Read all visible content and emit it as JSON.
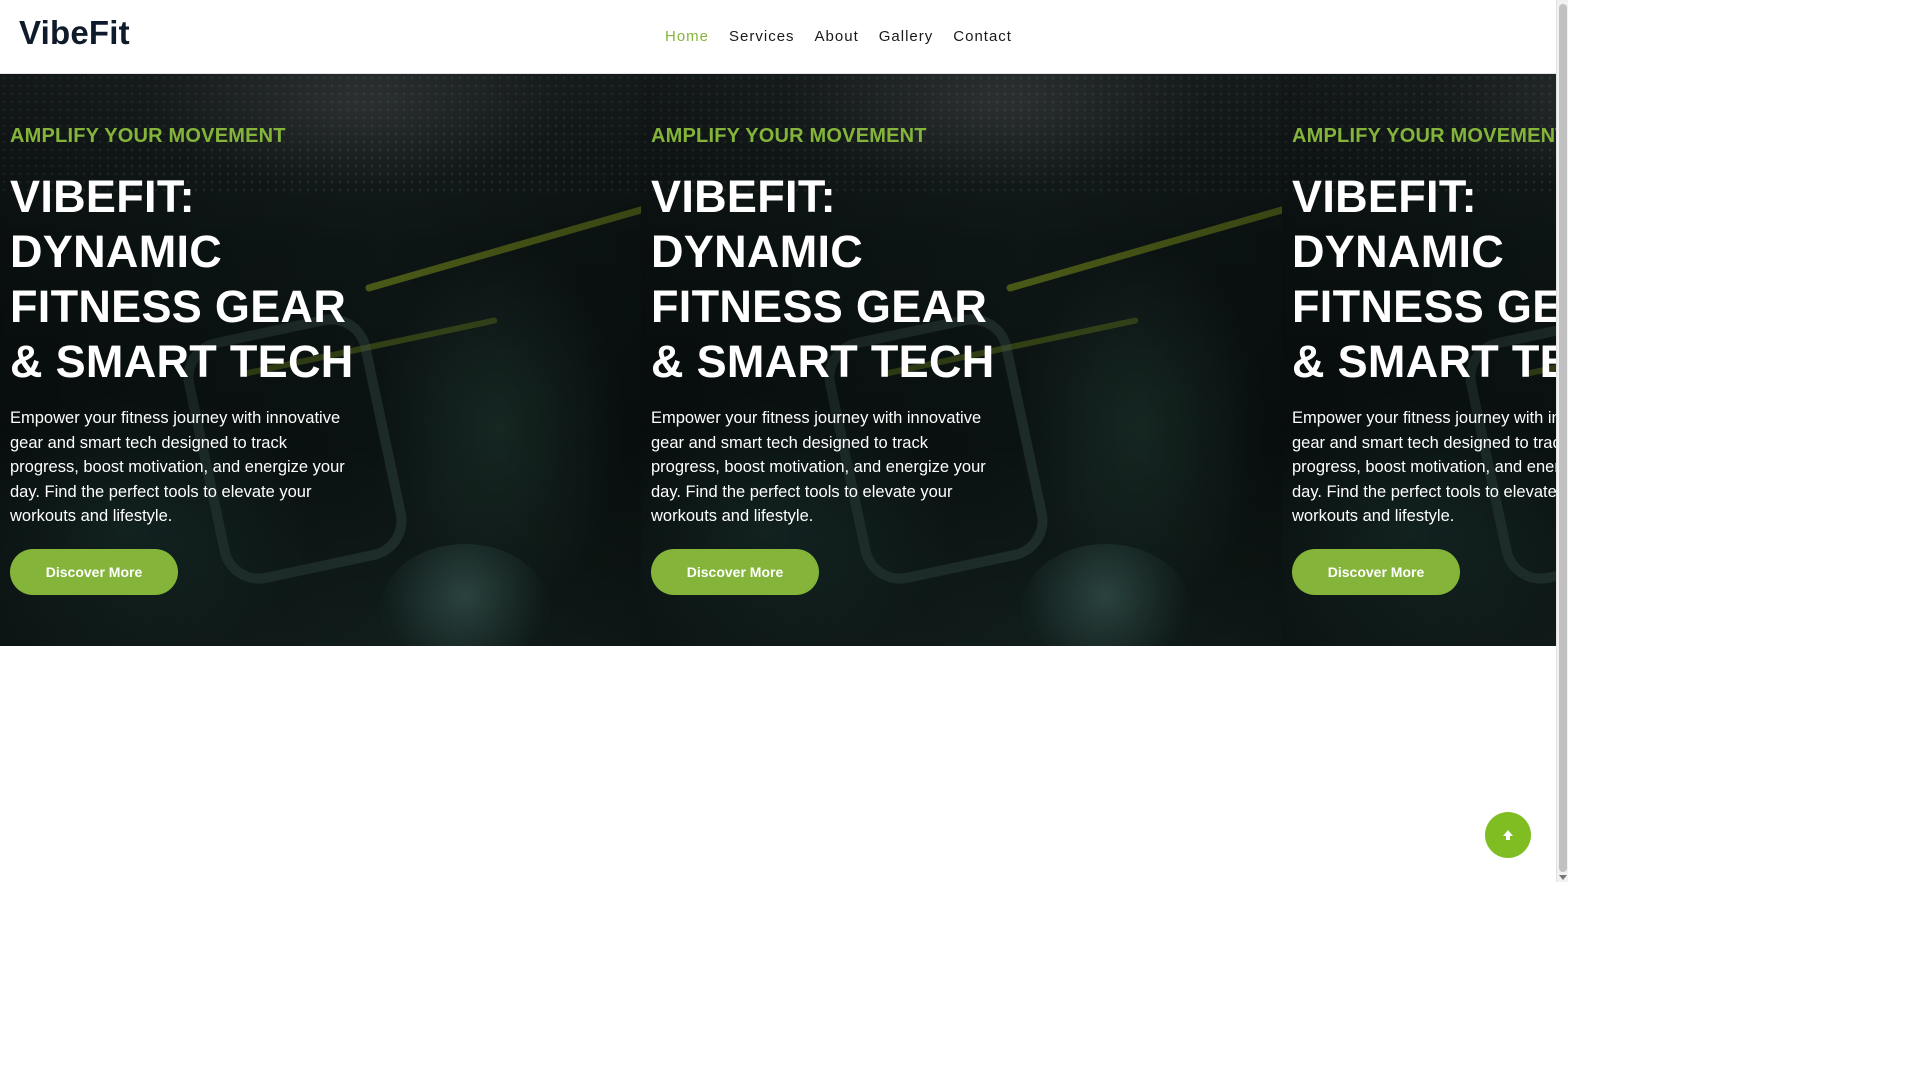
{
  "brand": {
    "name": "VibeFit",
    "accent": "#84b53a"
  },
  "nav": {
    "items": [
      {
        "label": "Home",
        "active": true
      },
      {
        "label": "Services",
        "active": false
      },
      {
        "label": "About",
        "active": false
      },
      {
        "label": "Gallery",
        "active": false
      },
      {
        "label": "Contact",
        "active": false
      }
    ]
  },
  "hero": {
    "slides": [
      {
        "kicker": "AMPLIFY YOUR MOVEMENT",
        "title": "VIBEFIT: DYNAMIC FITNESS GEAR & SMART TECH",
        "description": "Empower your fitness journey with innovative gear and smart tech designed to track progress, boost motivation, and energize your day. Find the perfect tools to elevate your workouts and lifestyle.",
        "button_label": "Discover More"
      },
      {
        "kicker": "AMPLIFY YOUR MOVEMENT",
        "title": "VIBEFIT: DYNAMIC FITNESS GEAR & SMART TECH",
        "description": "Empower your fitness journey with innovative gear and smart tech designed to track progress, boost motivation, and energize your day. Find the perfect tools to elevate your workouts and lifestyle.",
        "button_label": "Discover More"
      },
      {
        "kicker": "AMPLIFY YOUR MOVEMENT",
        "title": "VIBEFIT: DYNAMIC FITNESS GEAR & SMART TECH",
        "description": "Empower your fitness journey with innovative gear and smart tech designed to track progress, boost motivation, and energize your day. Find the perfect tools to elevate your workouts and lifestyle.",
        "button_label": "Discover More"
      }
    ]
  },
  "back_to_top": {
    "icon": "arrow-up-icon"
  }
}
